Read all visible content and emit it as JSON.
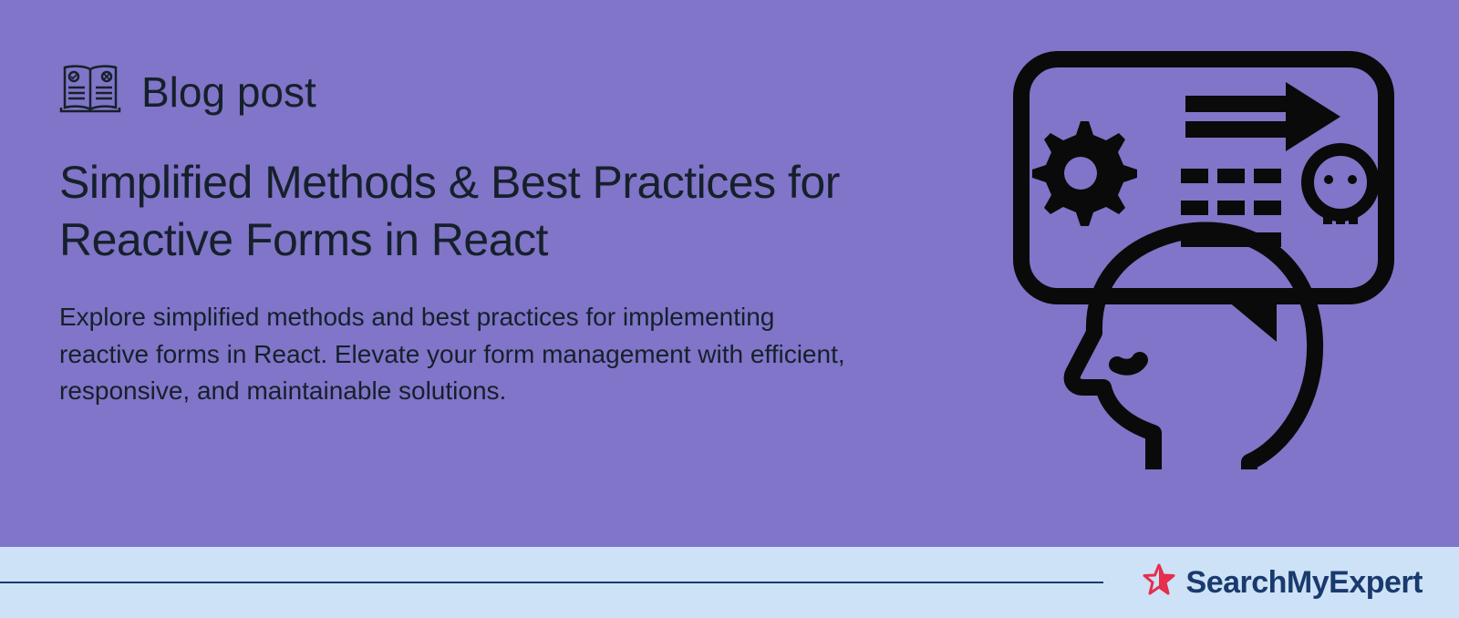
{
  "category": "Blog post",
  "title": "Simplified Methods & Best Practices for Reactive Forms in React",
  "description": "Explore simplified methods and best practices for implementing reactive forms in React. Elevate your form management with efficient, responsive, and maintainable solutions.",
  "brand": "SearchMyExpert",
  "colors": {
    "bg": "#8075c8",
    "text": "#16202b",
    "footerBg": "#cde2f6",
    "brandBlue": "#1a3a6e",
    "brandRed": "#e62e4d"
  }
}
